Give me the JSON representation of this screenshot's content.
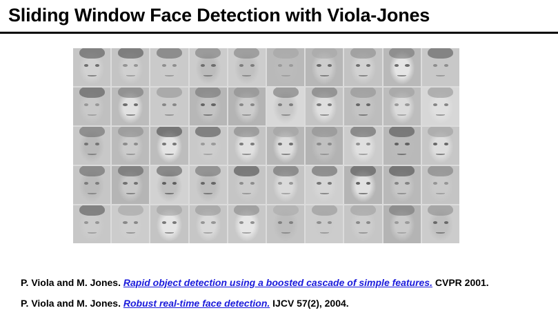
{
  "slide": {
    "title": "Sliding Window Face Detection with Viola-Jones"
  },
  "face_grid": {
    "rows": 5,
    "columns": 10,
    "tone": "grayscale"
  },
  "references": [
    {
      "authors": "P. Viola and M. Jones.",
      "link_text": "Rapid object detection using a boosted cascade of simple features.",
      "venue": "CVPR 2001."
    },
    {
      "authors": "P. Viola and M. Jones.",
      "link_text": "Robust real-time face detection.",
      "venue": "IJCV 57(2), 2004."
    }
  ],
  "colors": {
    "link": "#1a1adb",
    "rule": "#000000",
    "grid_background": "#dcdcdc"
  }
}
